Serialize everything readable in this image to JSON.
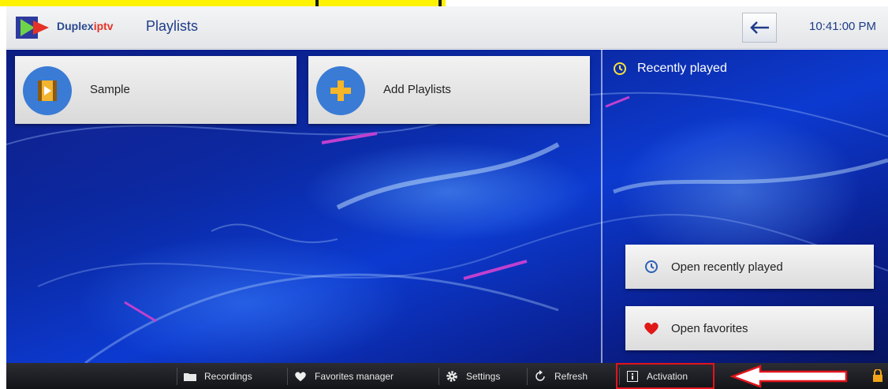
{
  "app": {
    "brand_prefix": "Duplex",
    "brand_suffix": "iptv",
    "page_title": "Playlists",
    "clock": "10:41:00 PM"
  },
  "playlists": [
    {
      "label": "Sample",
      "icon": "video-file-icon"
    },
    {
      "label": "Add Playlists",
      "icon": "plus-icon"
    }
  ],
  "side_panel": {
    "heading": "Recently played",
    "buttons": [
      {
        "label": "Open recently played",
        "icon": "history-icon"
      },
      {
        "label": "Open favorites",
        "icon": "heart-icon"
      }
    ]
  },
  "bottom_bar": [
    {
      "label": "Recordings",
      "icon": "folder-icon"
    },
    {
      "label": "Favorites manager",
      "icon": "heart-icon"
    },
    {
      "label": "Settings",
      "icon": "gear-icon"
    },
    {
      "label": "Refresh",
      "icon": "refresh-icon"
    },
    {
      "label": "Activation",
      "icon": "info-icon"
    }
  ],
  "colors": {
    "highlight": "#fff200",
    "annotation_red": "#e2141c",
    "brand_blue": "#2b4a8f",
    "brand_red": "#e63226"
  }
}
